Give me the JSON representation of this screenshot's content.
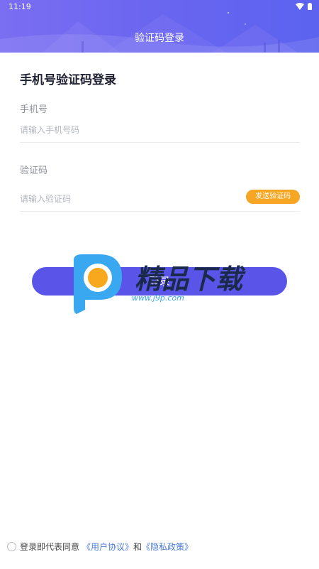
{
  "status_bar": {
    "time": "11:19"
  },
  "header": {
    "title": "验证码登录"
  },
  "form": {
    "heading": "手机号验证码登录",
    "phone": {
      "label": "手机号",
      "placeholder": "请输入手机号码",
      "value": ""
    },
    "code": {
      "label": "验证码",
      "placeholder": "请输入验证码",
      "value": "",
      "send_button": "发送验证码"
    },
    "submit_label": "登录"
  },
  "watermark": {
    "name": "精品下载",
    "url": "www.j9p.com"
  },
  "agreement": {
    "prefix": "登录即代表同意",
    "user_agreement": "《用户协议》",
    "conjunction": "和",
    "privacy_policy": "《隐私政策》"
  },
  "colors": {
    "primary": "#5a55e8",
    "accent": "#f6a623",
    "link": "#4a7ce0"
  }
}
